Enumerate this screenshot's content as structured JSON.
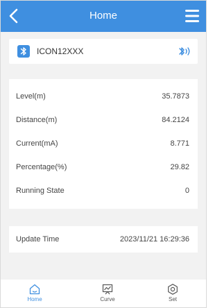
{
  "header": {
    "title": "Home"
  },
  "device": {
    "name": "ICON12XXX"
  },
  "measurements": [
    {
      "label": "Level(m)",
      "value": "35.7873"
    },
    {
      "label": "Distance(m)",
      "value": "84.2124"
    },
    {
      "label": "Current(mA)",
      "value": "8.771"
    },
    {
      "label": "Percentage(%)",
      "value": "29.82"
    },
    {
      "label": "Running State",
      "value": "0"
    }
  ],
  "update": {
    "label": "Update Time",
    "value": "2023/11/21 16:29:36"
  },
  "nav": {
    "items": [
      {
        "label": "Home",
        "icon": "home-icon",
        "active": true
      },
      {
        "label": "Curve",
        "icon": "chart-icon",
        "active": false
      },
      {
        "label": "Set",
        "icon": "settings-icon",
        "active": false
      }
    ]
  },
  "colors": {
    "primary": "#3f8fe0",
    "background": "#f2f2f2"
  }
}
